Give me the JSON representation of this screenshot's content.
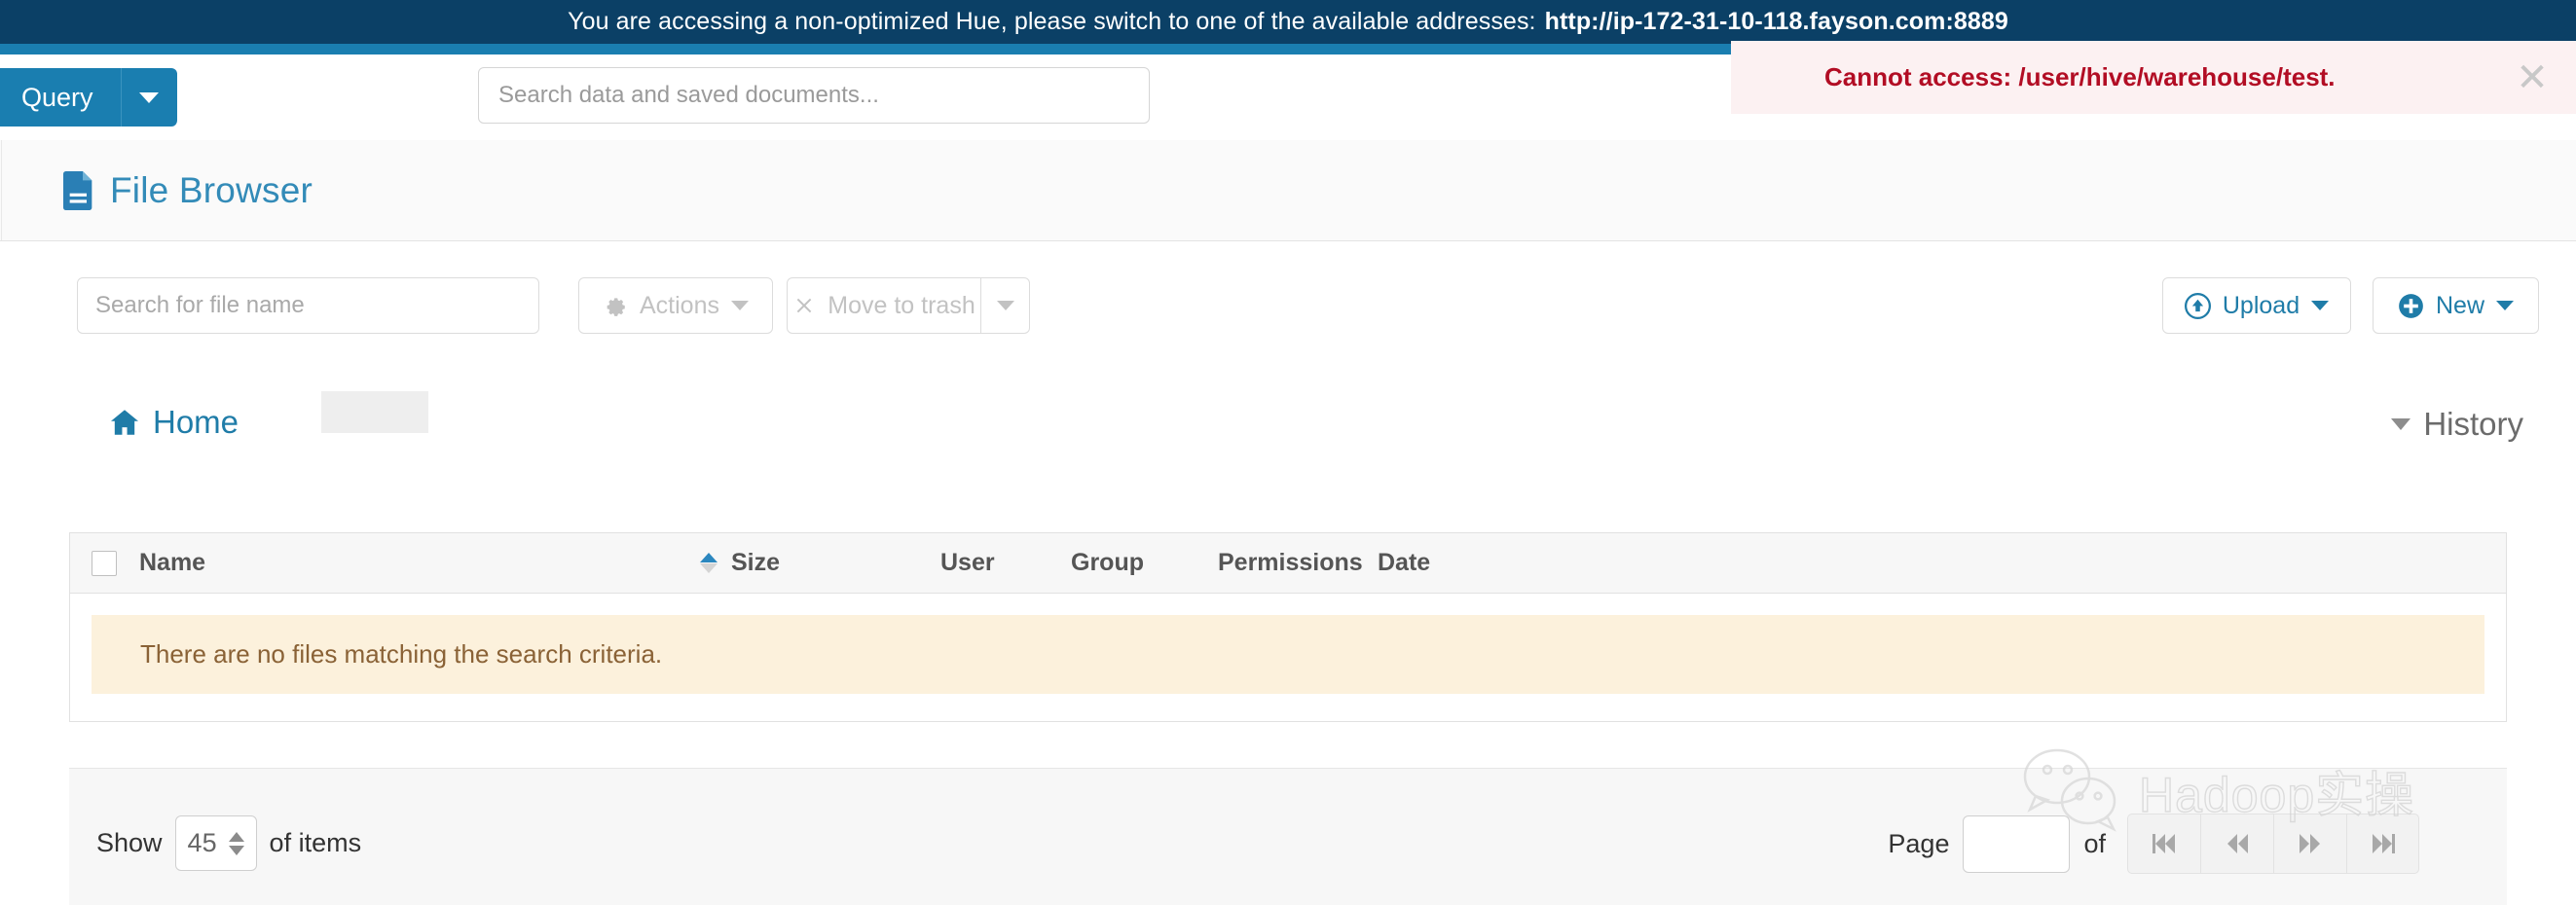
{
  "banner": {
    "message": "You are accessing a non-optimized Hue, please switch to one of the available addresses:",
    "url": "http://ip-172-31-10-118.fayson.com:8889",
    "bg_color": "#0b4066",
    "accent_color": "#1a7eb0"
  },
  "navbar": {
    "query_button_label": "Query",
    "query_caret_icon": "caret-down-icon",
    "search_placeholder": "Search data and saved documents...",
    "search_value": ""
  },
  "toast": {
    "message": "Cannot access: /user/hive/warehouse/test.",
    "close_icon": "close-icon",
    "text_color": "#b20d24",
    "bg_color": "#fcf1f2"
  },
  "page_header": {
    "icon": "file-document-icon",
    "title": "File Browser",
    "title_color": "#338bb8"
  },
  "toolbar": {
    "file_search_placeholder": "Search for file name",
    "file_search_value": "",
    "actions_label": "Actions",
    "actions_icon": "gear-icon",
    "actions_disabled": true,
    "trash_label": "Move to trash",
    "trash_icon": "x-mark-icon",
    "trash_disabled": true,
    "trash_caret_icon": "caret-down-icon",
    "upload_label": "Upload",
    "upload_icon": "upload-circle-icon",
    "new_label": "New",
    "new_icon": "plus-circle-icon"
  },
  "breadcrumb": {
    "home_label": "Home",
    "home_icon": "home-icon",
    "history_label": "History",
    "history_icon": "caret-down-icon"
  },
  "table": {
    "columns": [
      "Name",
      "Size",
      "User",
      "Group",
      "Permissions",
      "Date"
    ],
    "sort_column": "Size",
    "sort_direction": "asc",
    "select_all_checked": false,
    "rows": [],
    "empty_message": "There are no files matching the search criteria."
  },
  "footer": {
    "show_label": "Show",
    "show_value": "45",
    "of_items_label": "of items",
    "page_label": "Page",
    "page_value": "",
    "of_label": "of",
    "total_pages": "",
    "pager": [
      {
        "name": "first-page",
        "glyph": "⏮"
      },
      {
        "name": "previous-page",
        "glyph": "⏪"
      },
      {
        "name": "next-page",
        "glyph": "⏩"
      },
      {
        "name": "last-page",
        "glyph": "⏭"
      }
    ]
  },
  "watermark": {
    "text": "Hadoop实操",
    "icon": "wechat-icon"
  }
}
